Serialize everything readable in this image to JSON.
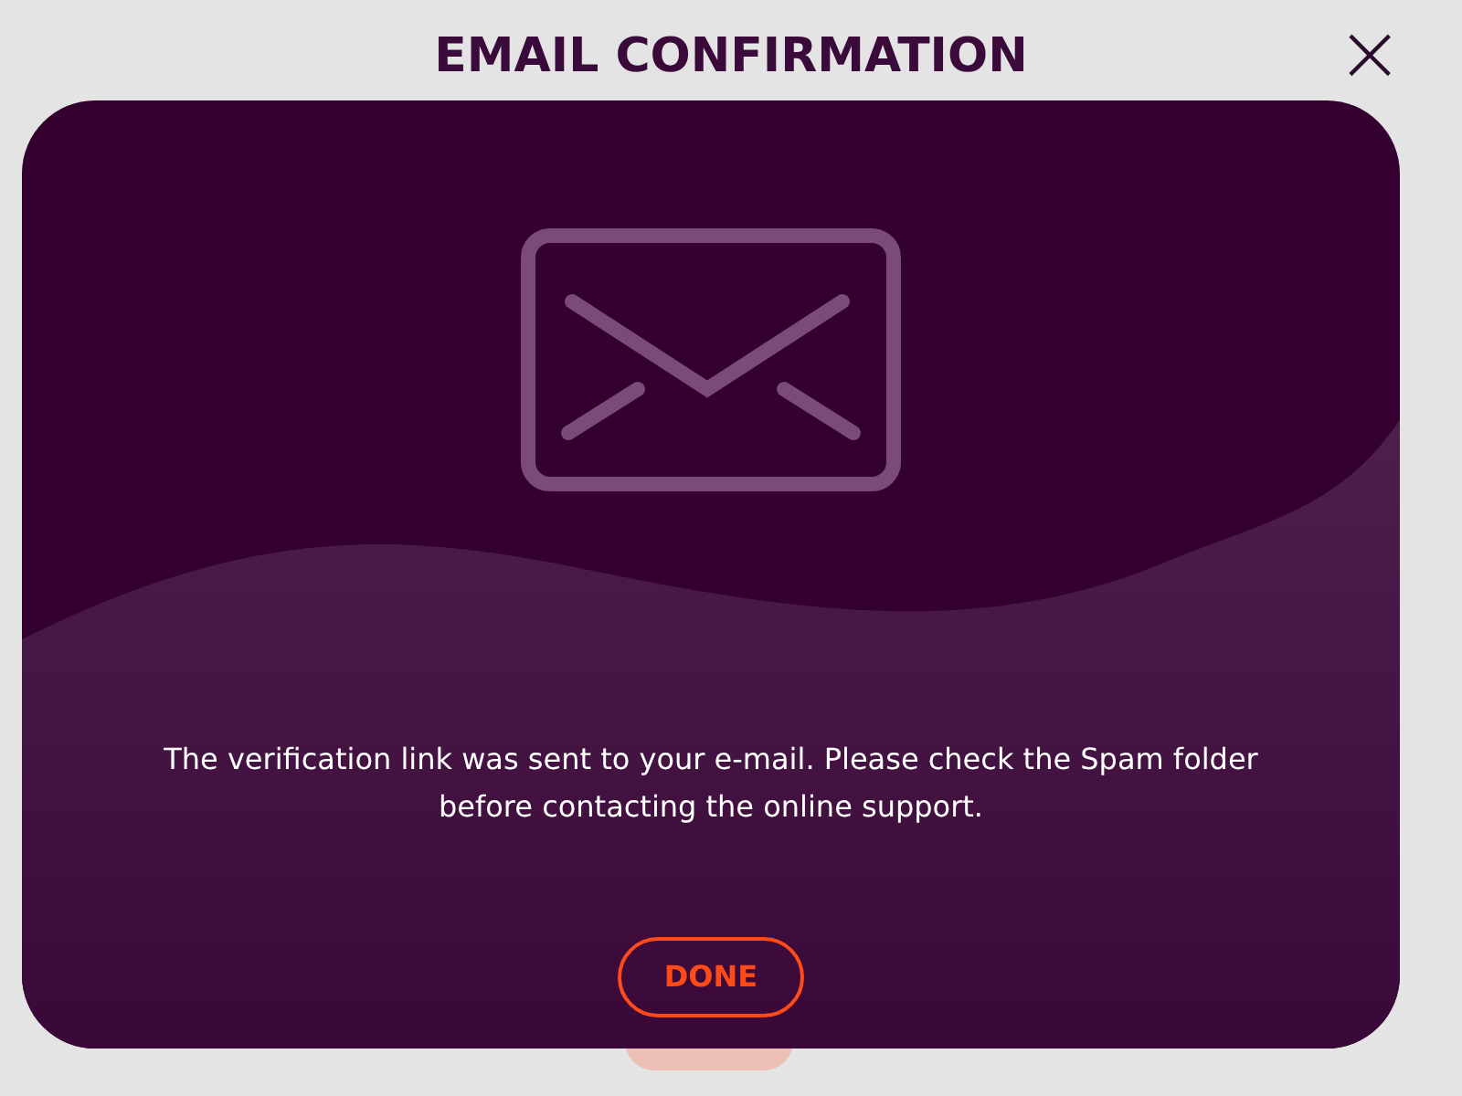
{
  "dialog": {
    "title": "EMAIL CONFIRMATION",
    "close_icon": "×",
    "message": "The verification link was sent to your e-mail. Please check the Spam folder before contacting the online support.",
    "button": "DONE"
  }
}
